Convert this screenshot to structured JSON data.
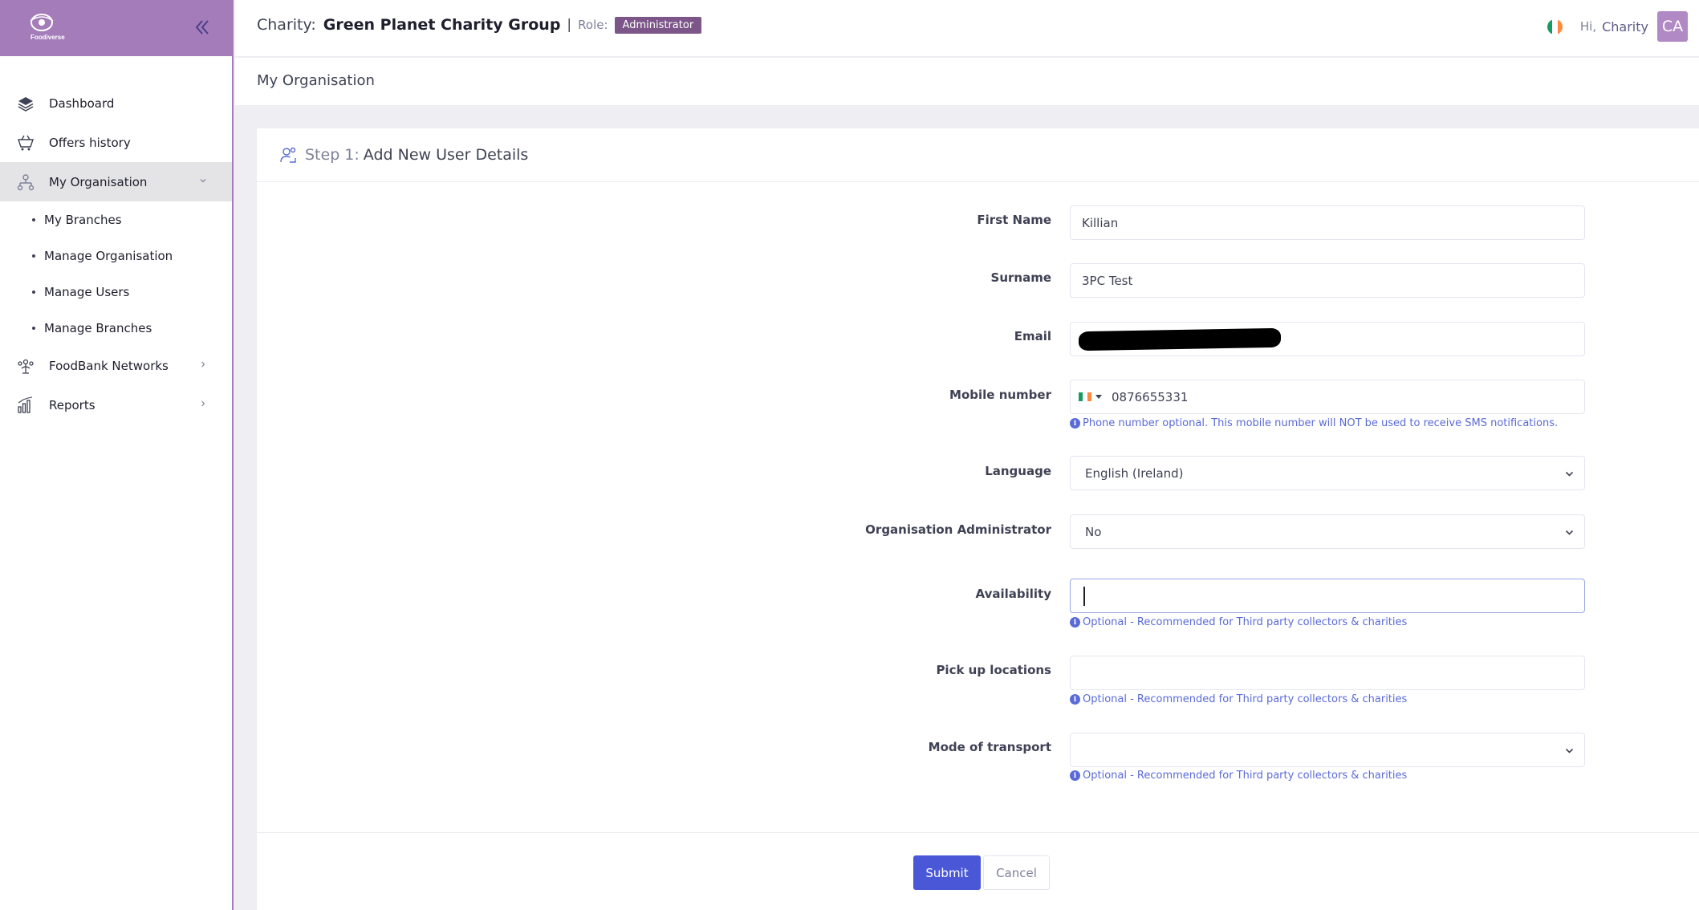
{
  "sidebar": {
    "logo_text": "Foodiverse",
    "items": [
      {
        "label": "Dashboard",
        "icon": "layers-icon"
      },
      {
        "label": "Offers history",
        "icon": "basket-icon"
      },
      {
        "label": "My Organisation",
        "icon": "org-chart-icon",
        "expanded": true
      },
      {
        "label": "FoodBank Networks",
        "icon": "network-icon"
      },
      {
        "label": "Reports",
        "icon": "bar-chart-icon"
      }
    ],
    "sub_items": [
      "My Branches",
      "Manage Organisation",
      "Manage Users",
      "Manage Branches"
    ]
  },
  "header": {
    "charity_label": "Charity:",
    "org_name": "Green Planet Charity Group",
    "separator": "|",
    "role_label": "Role:",
    "role": "Administrator",
    "greeting": "Hi,",
    "user_name": "Charity",
    "avatar_initials": "CA"
  },
  "subheader": {
    "title": "My Organisation"
  },
  "card": {
    "step_label": "Step 1:",
    "step_title": "Add New User Details"
  },
  "form": {
    "first_name_label": "First Name",
    "first_name_value": "Killian",
    "surname_label": "Surname",
    "surname_value": "3PC Test",
    "email_label": "Email",
    "mobile_label": "Mobile number",
    "mobile_value": "0876655331",
    "mobile_hint": "Phone number optional. This mobile number will NOT be used to receive SMS notifications.",
    "language_label": "Language",
    "language_value": "English (Ireland)",
    "org_admin_label": "Organisation Administrator",
    "org_admin_value": "No",
    "availability_label": "Availability",
    "availability_hint": "Optional - Recommended for Third party collectors & charities",
    "pickup_label": "Pick up locations",
    "pickup_hint": "Optional - Recommended for Third party collectors & charities",
    "transport_label": "Mode of transport",
    "transport_hint": "Optional - Recommended for Third party collectors & charities",
    "hint_icon": "i"
  },
  "buttons": {
    "submit": "Submit",
    "cancel": "Cancel"
  },
  "colors": {
    "brand": "#a47cba",
    "role_badge": "#7d5689",
    "primary": "#4a58d8",
    "hint": "#5a6bd6"
  }
}
